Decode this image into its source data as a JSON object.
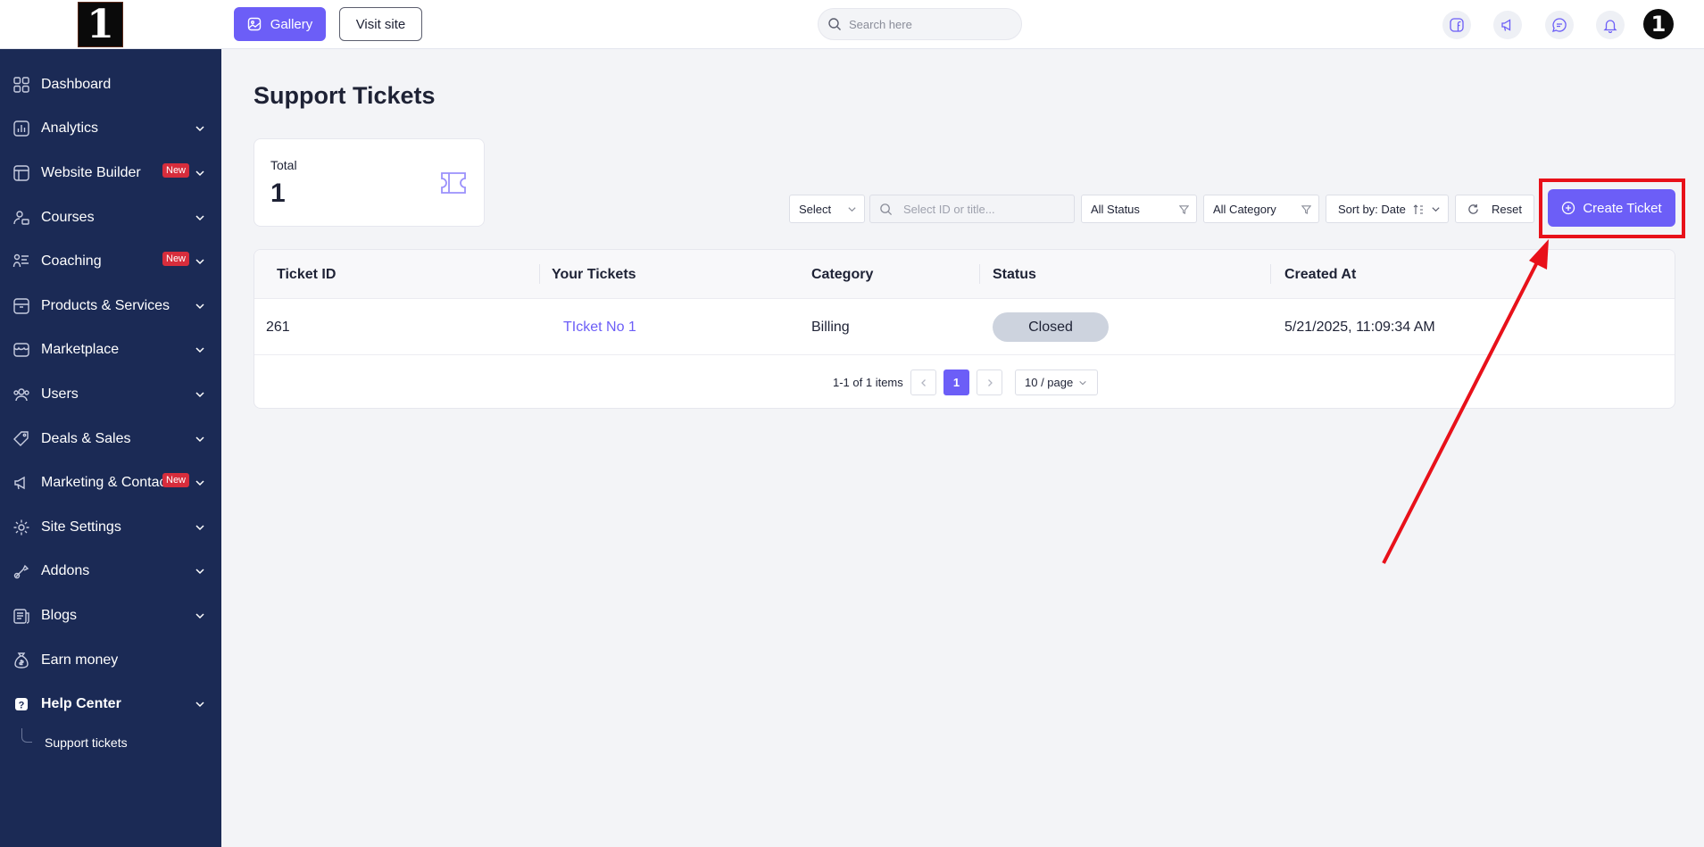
{
  "brand": {
    "logo_text": "1"
  },
  "topbar": {
    "gallery_label": "Gallery",
    "visit_label": "Visit site",
    "search_placeholder": "Search here",
    "avatar_text": "1"
  },
  "sidebar": {
    "items": [
      {
        "label": "Dashboard",
        "icon": "dashboard-icon",
        "chevron": false,
        "badge": ""
      },
      {
        "label": "Analytics",
        "icon": "analytics-icon",
        "chevron": true,
        "badge": ""
      },
      {
        "label": "Website Builder",
        "icon": "website-builder-icon",
        "chevron": true,
        "badge": "New"
      },
      {
        "label": "Courses",
        "icon": "courses-icon",
        "chevron": true,
        "badge": ""
      },
      {
        "label": "Coaching",
        "icon": "coaching-icon",
        "chevron": true,
        "badge": "New"
      },
      {
        "label": "Products & Services",
        "icon": "products-icon",
        "chevron": true,
        "badge": ""
      },
      {
        "label": "Marketplace",
        "icon": "marketplace-icon",
        "chevron": true,
        "badge": ""
      },
      {
        "label": "Users",
        "icon": "users-icon",
        "chevron": true,
        "badge": ""
      },
      {
        "label": "Deals & Sales",
        "icon": "deals-icon",
        "chevron": true,
        "badge": ""
      },
      {
        "label": "Marketing & Contacts",
        "icon": "marketing-icon",
        "chevron": true,
        "badge": "New"
      },
      {
        "label": "Site Settings",
        "icon": "settings-icon",
        "chevron": true,
        "badge": ""
      },
      {
        "label": "Addons",
        "icon": "addons-icon",
        "chevron": true,
        "badge": ""
      },
      {
        "label": "Blogs",
        "icon": "blogs-icon",
        "chevron": true,
        "badge": ""
      },
      {
        "label": "Earn money",
        "icon": "money-bag-icon",
        "chevron": false,
        "badge": ""
      },
      {
        "label": "Help Center",
        "icon": "help-icon",
        "chevron": true,
        "badge": ""
      }
    ],
    "subitem_label": "Support tickets"
  },
  "main": {
    "title": "Support Tickets",
    "total_label": "Total",
    "total_value": "1",
    "filters": {
      "select_label": "Select",
      "search_placeholder": "Select ID or title...",
      "status_label": "All Status",
      "category_label": "All Category",
      "sort_label": "Sort by: Date",
      "reset_label": "Reset",
      "create_label": "Create Ticket"
    },
    "table": {
      "headers": [
        "Ticket ID",
        "Your Tickets",
        "Category",
        "Status",
        "Created At"
      ],
      "rows": [
        {
          "id": "261",
          "title": "TIcket No 1",
          "category": "Billing",
          "status": "Closed",
          "created": "5/21/2025, 11:09:34 AM"
        }
      ]
    },
    "pagination": {
      "summary": "1-1 of 1 items",
      "current_page": "1",
      "page_size": "10 / page"
    }
  },
  "colors": {
    "accent": "#6c5ef7",
    "sidebar_bg": "#1b2a55",
    "badge": "#d72d3c",
    "highlight": "#e8111a"
  }
}
